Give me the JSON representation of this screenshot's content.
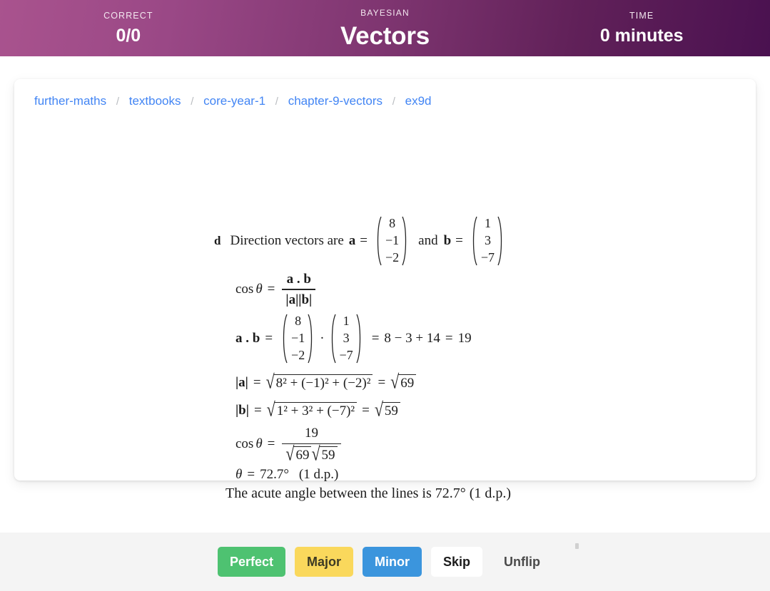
{
  "header": {
    "correct": {
      "label": "CORRECT",
      "value": "0/0"
    },
    "center": {
      "label": "BAYESIAN",
      "value": "Vectors"
    },
    "time": {
      "label": "TIME",
      "value": "0 minutes"
    },
    "gradient_from": "#a9538e",
    "gradient_to": "#4a1150"
  },
  "breadcrumb": {
    "separator": "/",
    "items": [
      {
        "label": "further-maths"
      },
      {
        "label": "textbooks"
      },
      {
        "label": "core-year-1"
      },
      {
        "label": "chapter-9-vectors"
      },
      {
        "label": "ex9d"
      }
    ],
    "link_color": "#4285f4"
  },
  "solution": {
    "part_label": "d",
    "line1": {
      "text_before": "Direction vectors are",
      "vec_a_name": "a",
      "equals": "=",
      "vec_a": [
        "8",
        "−1",
        "−2"
      ],
      "conjunction": "and",
      "vec_b_name": "b",
      "vec_b": [
        "1",
        "3",
        "−7"
      ]
    },
    "line2": {
      "lhs": "cos",
      "theta": "θ",
      "equals": "=",
      "numerator": "a . b",
      "denominator": "|a||b|"
    },
    "line3": {
      "lhs": "a . b",
      "equals": "=",
      "vec_a": [
        "8",
        "−1",
        "−2"
      ],
      "dot": "·",
      "vec_b": [
        "1",
        "3",
        "−7"
      ],
      "equals2": "=",
      "expansion": "8 − 3 + 14",
      "equals3": "=",
      "result": "19"
    },
    "line4": {
      "lhs": "|a|",
      "equals": "=",
      "radicand_parts": [
        "8",
        "2",
        " + (−1)",
        "2",
        " + (−2)",
        "2"
      ],
      "radicand_text": "8² + (−1)² + (−2)²",
      "equals2": "=",
      "result_radicand": "69"
    },
    "line5": {
      "lhs": "|b|",
      "equals": "=",
      "radicand_text": "1² + 3² + (−7)²",
      "equals2": "=",
      "result_radicand": "59"
    },
    "line6": {
      "lhs": "cos",
      "theta": "θ",
      "equals": "=",
      "numerator": "19",
      "den_first_radicand": "69",
      "den_second_radicand": "59"
    },
    "line7": {
      "theta": "θ",
      "equals": "=",
      "value": "72.7°",
      "precision": "(1 d.p.)"
    },
    "line8": {
      "text": "The acute angle between the lines is 72.7° (1 d.p.)"
    }
  },
  "footer": {
    "buttons": [
      {
        "label": "Perfect",
        "color": "#4ec271"
      },
      {
        "label": "Major",
        "color": "#fad85c"
      },
      {
        "label": "Minor",
        "color": "#3b95dd"
      },
      {
        "label": "Skip",
        "color": "#ffffff"
      },
      {
        "label": "Unflip",
        "color": "transparent"
      }
    ]
  }
}
